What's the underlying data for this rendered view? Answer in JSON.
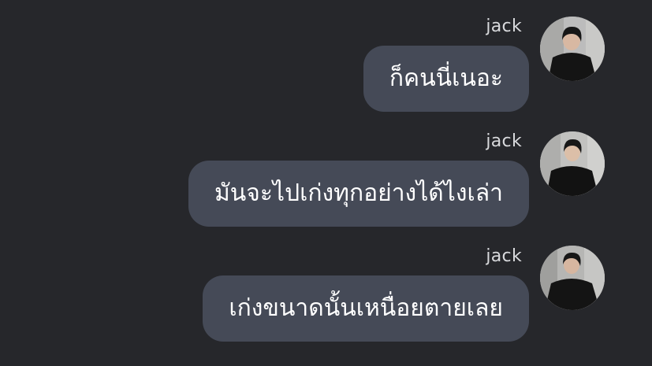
{
  "colors": {
    "background": "#26272b",
    "bubble": "#454a57",
    "sender_text": "#d9dadd",
    "message_text": "#ffffff"
  },
  "messages": [
    {
      "sender": "jack",
      "text": "ก็คนนี่เนอะ",
      "avatar_icon": "user-photo"
    },
    {
      "sender": "jack",
      "text": "มันจะไปเก่งทุกอย่างได้ไงเล่า",
      "avatar_icon": "user-photo"
    },
    {
      "sender": "jack",
      "text": "เก่งขนาดนั้นเหนื่อยตายเลย",
      "avatar_icon": "user-photo"
    }
  ]
}
